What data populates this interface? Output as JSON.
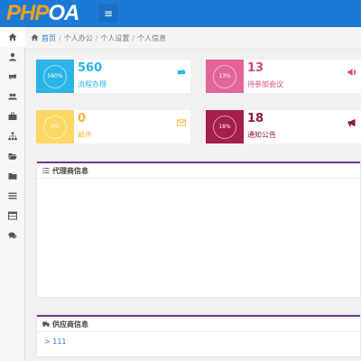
{
  "logo": {
    "part1": "PHP",
    "part2": "OA"
  },
  "toggle_icon": "bars-icon",
  "sidebar": {
    "items": [
      {
        "icon": "home-icon"
      },
      {
        "icon": "user-icon"
      },
      {
        "icon": "refresh-icon"
      },
      {
        "icon": "users-icon"
      },
      {
        "icon": "briefcase-icon"
      },
      {
        "icon": "sitemap-icon"
      },
      {
        "icon": "folder-open-icon"
      },
      {
        "icon": "folder-icon"
      },
      {
        "icon": "list-icon"
      },
      {
        "icon": "table-icon"
      },
      {
        "icon": "comments-icon"
      }
    ]
  },
  "breadcrumb": {
    "home": "首页",
    "items": [
      "个人办公",
      "个人设置",
      "个人信息"
    ]
  },
  "cards": [
    {
      "value": "560",
      "label": "流程办理",
      "percent": "560%",
      "tile_color": "#2bb5e6",
      "accent": "#2bb5e6",
      "icon": "retweet-icon"
    },
    {
      "value": "13",
      "label": "待参加会议",
      "percent": "13%",
      "tile_color": "#e2649b",
      "accent": "#d6457f",
      "icon": "volume-icon"
    },
    {
      "value": "0",
      "label": "邮件",
      "percent": "0%",
      "tile_color": "#fbd766",
      "accent": "#f3b53c",
      "icon": "envelope-icon"
    },
    {
      "value": "18",
      "label": "通知公告",
      "percent": "18%",
      "tile_color": "#a61e4a",
      "accent": "#8e1a40",
      "icon": "bullhorn-icon"
    }
  ],
  "panels": {
    "agent": {
      "title": "代理商信息",
      "icon": "list-ol-icon"
    },
    "supplier": {
      "title": "供应商信息",
      "icon": "truck-icon",
      "link": "> 111"
    }
  }
}
